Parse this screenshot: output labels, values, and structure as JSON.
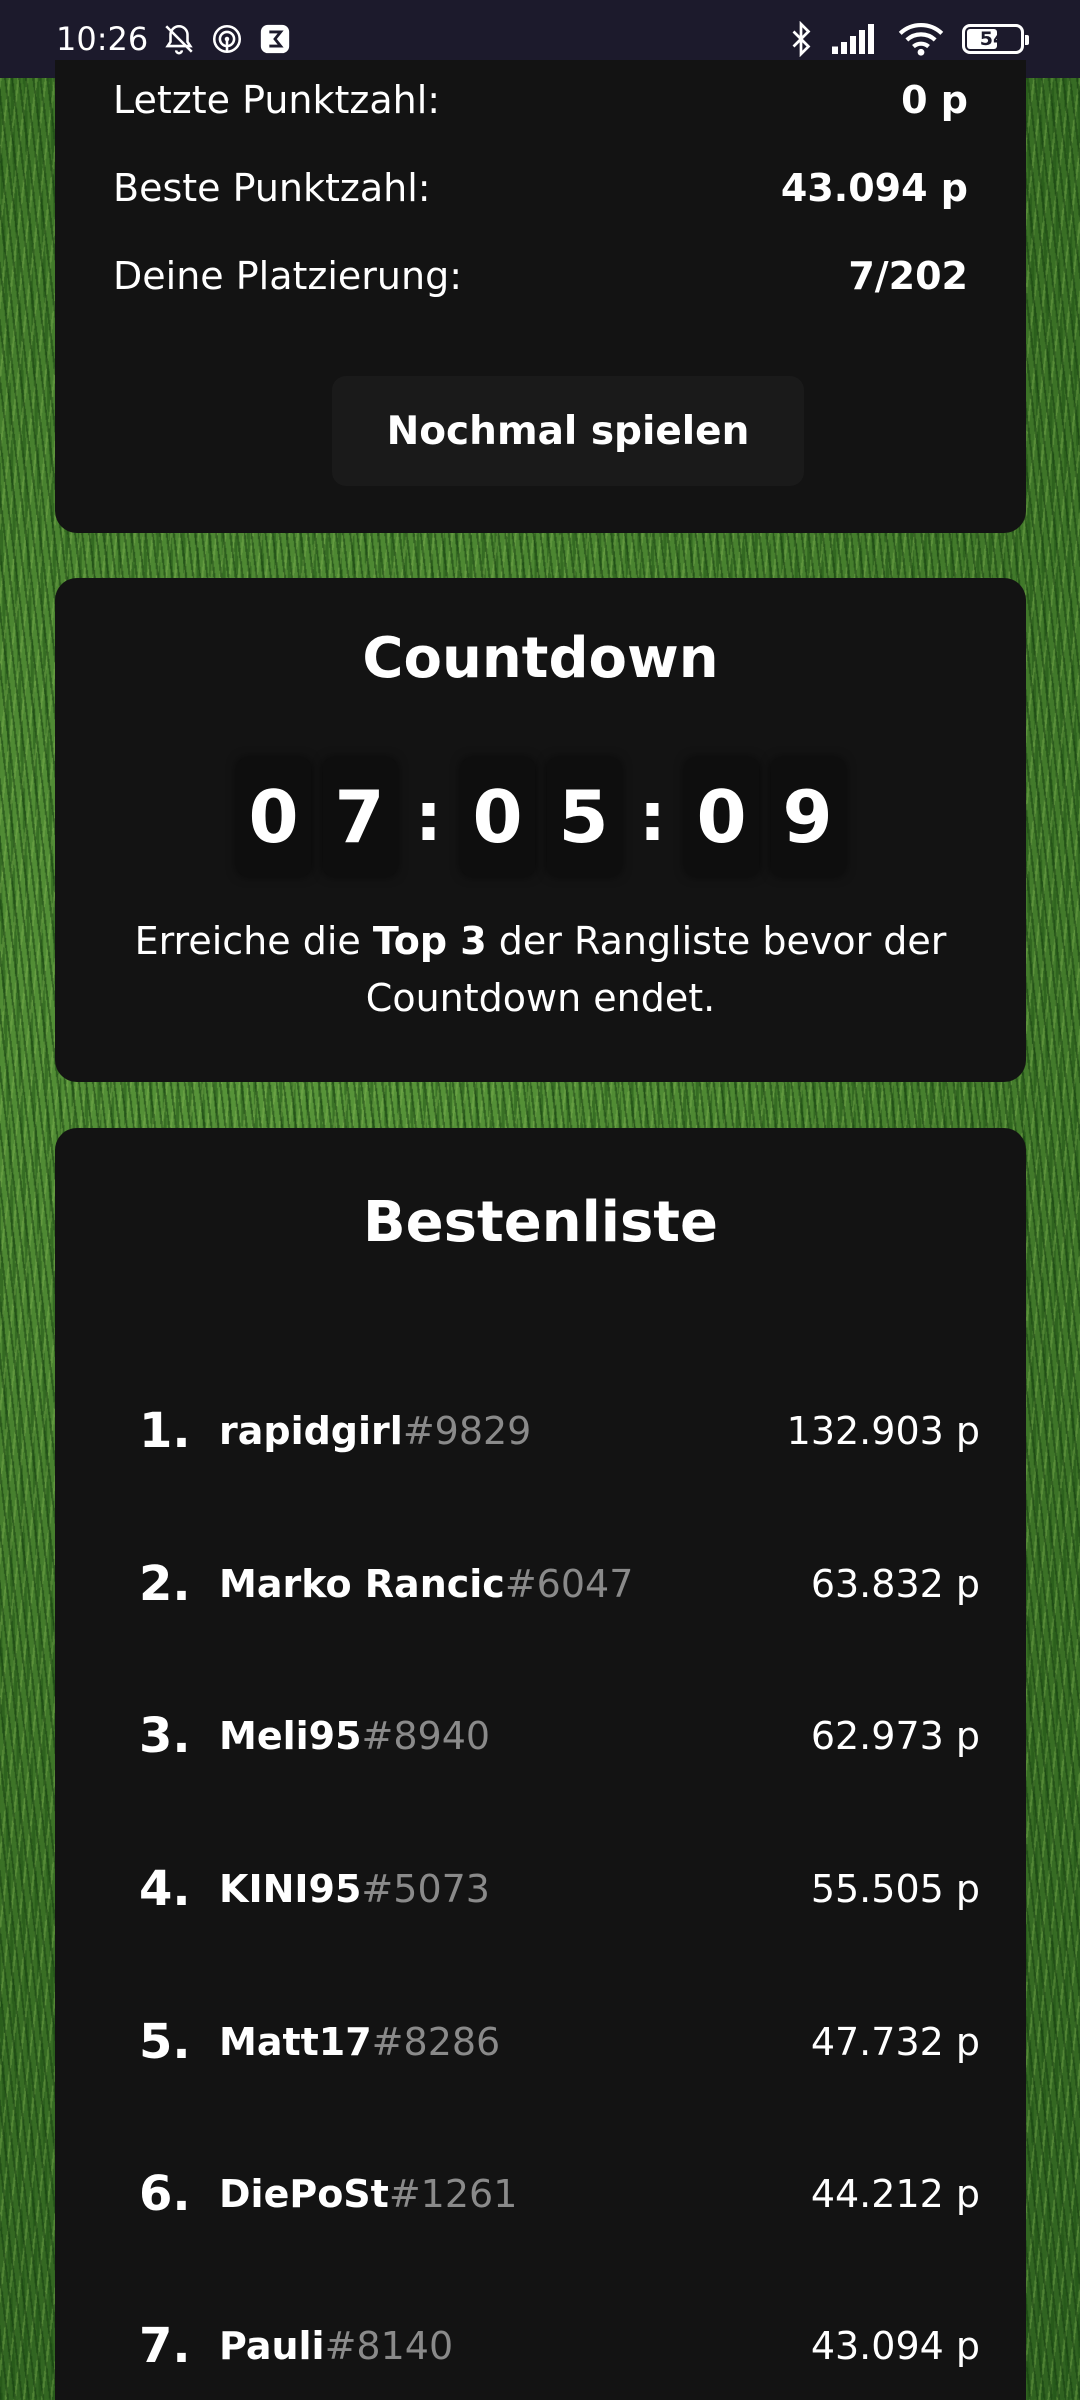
{
  "status_bar": {
    "time": "10:26",
    "battery": "54",
    "icons": [
      "bell-off-icon",
      "hotspot-icon",
      "app-notification-icon",
      "bluetooth-icon",
      "signal-icon",
      "wifi-icon",
      "battery-icon"
    ]
  },
  "score": {
    "last_label": "Letzte Punktzahl:",
    "last_value": "0 p",
    "best_label": "Beste Punktzahl:",
    "best_value": "43.094 p",
    "rank_label": "Deine Platzierung:",
    "rank_value": "7/202",
    "replay_label": "Nochmal spielen"
  },
  "countdown": {
    "title": "Countdown",
    "digits": [
      "0",
      "7",
      ":",
      "0",
      "5",
      ":",
      "0",
      "9"
    ],
    "text_pre": "Erreiche die ",
    "text_bold": "Top 3",
    "text_post": " der Rangliste bevor der Countdown endet."
  },
  "leaderboard": {
    "title": "Bestenliste",
    "rows": [
      {
        "rank": "1.",
        "name": "rapidgirl",
        "tag": "#9829",
        "points": "132.903 p"
      },
      {
        "rank": "2.",
        "name": "Marko Rancic",
        "tag": "#6047",
        "points": "63.832 p"
      },
      {
        "rank": "3.",
        "name": "Meli95",
        "tag": "#8940",
        "points": "62.973 p"
      },
      {
        "rank": "4.",
        "name": "KINI95",
        "tag": "#5073",
        "points": "55.505 p"
      },
      {
        "rank": "5.",
        "name": "Matt17",
        "tag": "#8286",
        "points": "47.732 p"
      },
      {
        "rank": "6.",
        "name": "DiePoSt",
        "tag": "#1261",
        "points": "44.212 p"
      },
      {
        "rank": "7.",
        "name": "Pauli",
        "tag": "#8140",
        "points": "43.094 p"
      }
    ]
  }
}
